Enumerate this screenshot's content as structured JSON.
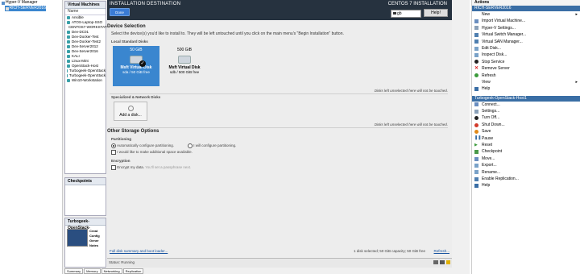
{
  "tree": {
    "root": "Hyper-V Manager",
    "server": "RICH-SERVER2016"
  },
  "vms": {
    "title": "Virtual Machines",
    "column": "Name",
    "items": [
      "Ansible",
      "ATOS-Laptop-SSO",
      "CENTOS7-WORKSTATI",
      "Dev-DC01",
      "Dev-Docker-Test",
      "Dev-Docker-Test2",
      "Dev-Server2012",
      "Dev-Server2016",
      "KALI",
      "Linux-Mint",
      "OpenStack-Host",
      "Turbogeek-OpenStack",
      "Turbogeek-OpenStack",
      "Win10-Workstation"
    ]
  },
  "checkpoints": {
    "title": "Checkpoints"
  },
  "details": {
    "title": "Turbogeek-OpenStack-",
    "labels": [
      "Creat",
      "Config",
      "Gener",
      "Notes"
    ]
  },
  "bottom_tabs": [
    "Summary",
    "Memory",
    "Networking",
    "Replication"
  ],
  "installer": {
    "title": "INSTALLATION DESTINATION",
    "done": "Done",
    "os_title": "CENTOS 7 INSTALLATION",
    "keyboard": "gb",
    "help": "Help!",
    "device_selection": "Device Selection",
    "device_desc": "Select the device(s) you'd like to install to.  They will be left untouched until you click on the main menu's \"Begin Installation\" button.",
    "local_disks": "Local Standard Disks",
    "disks": [
      {
        "size": "50 GiB",
        "name": "Msft Virtual Disk",
        "info": "sda  /  50 GiB free"
      },
      {
        "size": "500 GiB",
        "name": "Msft Virtual Disk",
        "info": "sdb  /  500 GiB free"
      }
    ],
    "untouched_note": "Disks left unselected here will not be touched.",
    "specialized": "Specialized & Network Disks",
    "add_disk": "Add a disk...",
    "untouched_note2": "Disks left unselected here will not be touched.",
    "other_storage": "Other Storage Options",
    "partitioning": "Partitioning",
    "auto_partition": "Automatically configure partitioning.",
    "manual_partition": "I will configure partitioning.",
    "extra_space": "I would like to make additional space available.",
    "encryption": "Encryption",
    "encrypt": "Encrypt my data.",
    "encrypt_hint": "You'll set a passphrase next.",
    "summary_link": "Full disk summary and boot loader...",
    "selected_summary": "1 disk selected; 50 GiB capacity; 50 GiB free",
    "refresh": "Refresh...",
    "status": "Status: Running"
  },
  "actions": {
    "title": "Actions",
    "server_head": "RICH-SERVER2016",
    "server_items": [
      "New",
      "Import Virtual Machine...",
      "Hyper-V Settings...",
      "Virtual Switch Manager...",
      "Virtual SAN Manager...",
      "Edit Disk...",
      "Inspect Disk...",
      "Stop Service",
      "Remove Server",
      "Refresh",
      "View",
      "Help"
    ],
    "vm_head": "Turbogeek-OpenStack-Host1",
    "vm_items": [
      "Connect...",
      "Settings...",
      "Turn Off...",
      "Shut Down...",
      "Save",
      "Pause",
      "Reset",
      "Checkpoint",
      "Move...",
      "Export...",
      "Rename...",
      "Enable Replication...",
      "Help"
    ]
  },
  "colors": {
    "accent": "#3a86cf",
    "header": "#26323f",
    "done": "#3a7bd5"
  }
}
